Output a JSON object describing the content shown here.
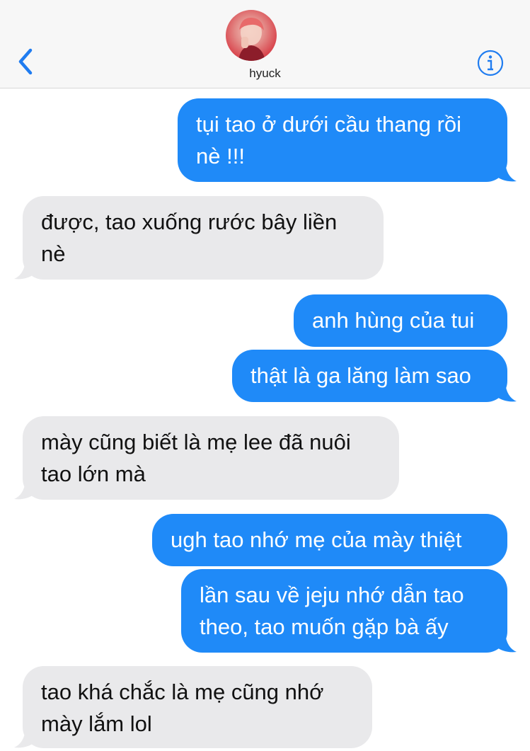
{
  "header": {
    "contact_name": "hyuck",
    "back_icon": "chevron-left-icon",
    "info_icon": "info-icon",
    "accent_color": "#1f8af8"
  },
  "messages": [
    {
      "direction": "outgoing",
      "text": "tụi tao ở dưới cầu thang rồi\nnè !!!"
    },
    {
      "direction": "incoming",
      "text": "được, tao xuống rước bây liền\nnè"
    },
    {
      "direction": "outgoing",
      "text": "anh hùng của tui"
    },
    {
      "direction": "outgoing",
      "text": "thật là ga lăng làm sao"
    },
    {
      "direction": "incoming",
      "text": "mày cũng biết là mẹ lee đã nuôi\ntao lớn mà"
    },
    {
      "direction": "outgoing",
      "text": "ugh tao nhớ mẹ của mày thiệt"
    },
    {
      "direction": "outgoing",
      "text": "lần sau về jeju nhớ dẫn tao\ntheo, tao muốn gặp bà ấy"
    },
    {
      "direction": "incoming",
      "text": "tao khá chắc là mẹ cũng nhớ\nmày lắm lol"
    }
  ],
  "colors": {
    "outgoing_bubble": "#1f8af8",
    "incoming_bubble": "#e9e9eb",
    "header_background": "#f7f7f7"
  }
}
